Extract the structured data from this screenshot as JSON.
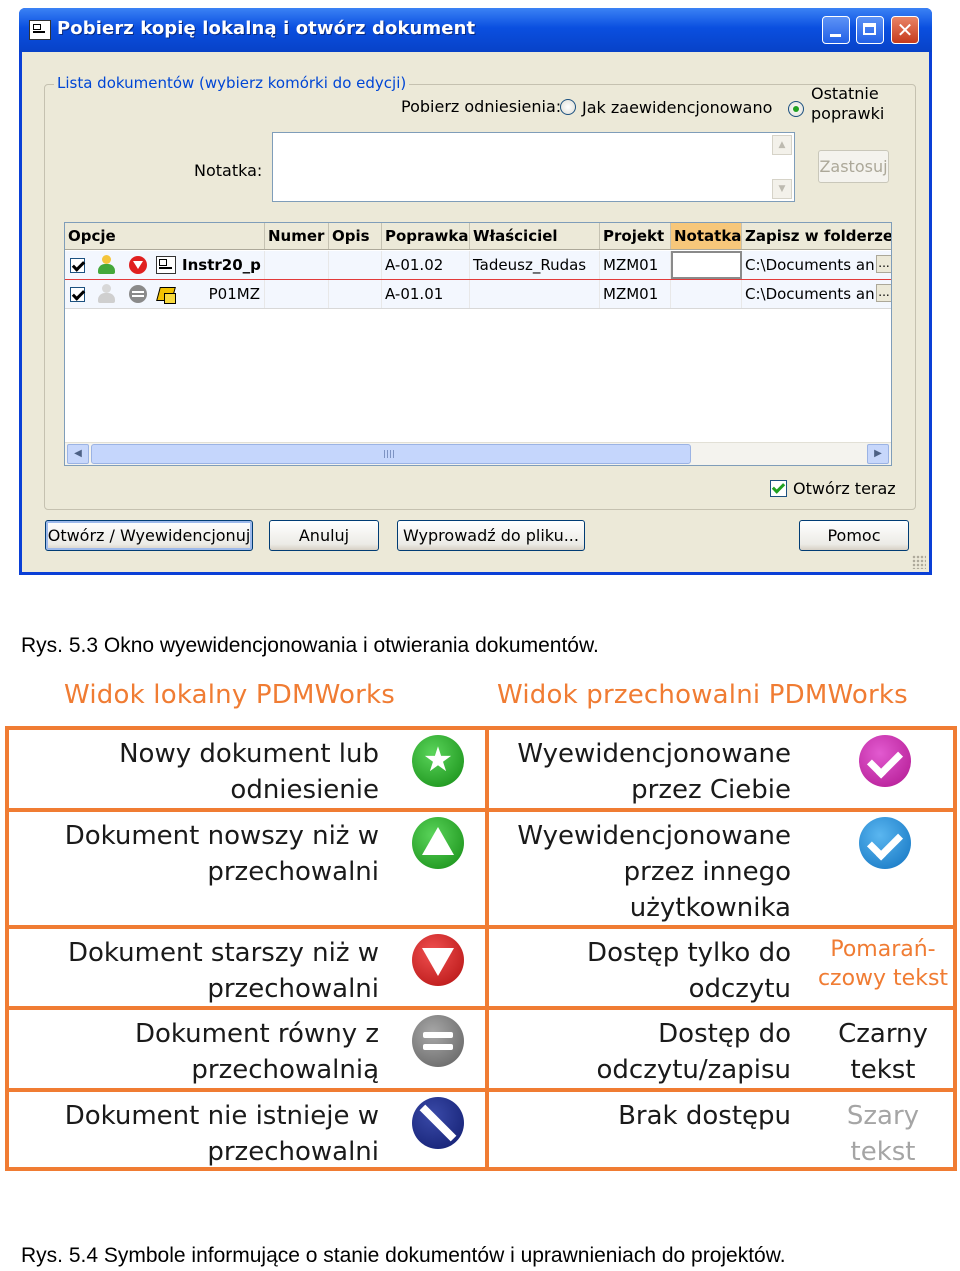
{
  "window": {
    "title": "Pobierz kopię lokalną i otwórz dokument",
    "group_label": "Lista dokumentów (wybierz komórki do edycji)",
    "reference_label": "Pobierz odniesienia:",
    "radio_checked_in": "Jak zaewidencjonowano",
    "radio_latest_line1": "Ostatnie",
    "radio_latest_line2": "poprawki",
    "note_label": "Notatka:",
    "apply_button": "Zastosuj",
    "columns": [
      "Opcje",
      "Numer",
      "Opis",
      "Poprawka",
      "Właściciel",
      "Projekt",
      "Notatka",
      "Zapisz w folderze"
    ],
    "rows": [
      {
        "name": "Instr20_p",
        "revision": "A-01.02",
        "owner": "Tadeusz_Rudas",
        "project": "MZM01",
        "folder": "C:\\Documents an",
        "ellipsis": "..."
      },
      {
        "name": "P01MZ",
        "revision": "A-01.01",
        "owner": "",
        "project": "MZM01",
        "folder": "C:\\Documents an",
        "ellipsis": "..."
      }
    ],
    "open_now_label": "Otwórz teraz",
    "buttons": {
      "open_checkin": "Otwórz / Wyewidencjonuj",
      "cancel": "Anuluj",
      "export": "Wyprowadź do pliku...",
      "help": "Pomoc"
    },
    "colors": {
      "titlebar": "#0a4fe0",
      "face": "#ece9d8",
      "highlight_column": "#f7c77a"
    }
  },
  "caption_53": "Rys. 5.3 Okno wyewidencjonowania i otwierania dokumentów.",
  "legend": {
    "left_header": "Widok lokalny PDMWorks",
    "right_header": "Widok przechowalni PDMWorks",
    "left_items": [
      {
        "text": "Nowy dokument lub\nodniesienie",
        "icon": "green-star-icon"
      },
      {
        "text": "Dokument nowszy niż w\nprzechowalni",
        "icon": "green-up-triangle-icon"
      },
      {
        "text": "Dokument starszy niż w\nprzechowalni",
        "icon": "red-down-triangle-icon"
      },
      {
        "text": "Dokument równy z\nprzechowalnią",
        "icon": "gray-equals-icon"
      },
      {
        "text": "Dokument nie istnieje w\nprzechowalni",
        "icon": "blue-slash-icon"
      }
    ],
    "right_items": [
      {
        "text": "Wyewidencjonowane\nprzez Ciebie",
        "icon": "magenta-check-icon"
      },
      {
        "text": "Wyewidencjonowane\nprzez innego\nużytkownika",
        "icon": "blue-check-icon"
      },
      {
        "text": "Dostęp tylko do\nodczytu",
        "side": "Pomarań-\nczowy tekst"
      },
      {
        "text": "Dostęp do\nodczytu/zapisu",
        "side": "Czarny\ntekst"
      },
      {
        "text": "Brak dostępu",
        "side": "Szary\ntekst"
      }
    ],
    "colors": {
      "accent": "#f07c33",
      "gray_text": "#a5a5a5"
    }
  },
  "caption_54": "Rys. 5.4 Symbole informujące o stanie dokumentów i uprawnieniach do projektów."
}
